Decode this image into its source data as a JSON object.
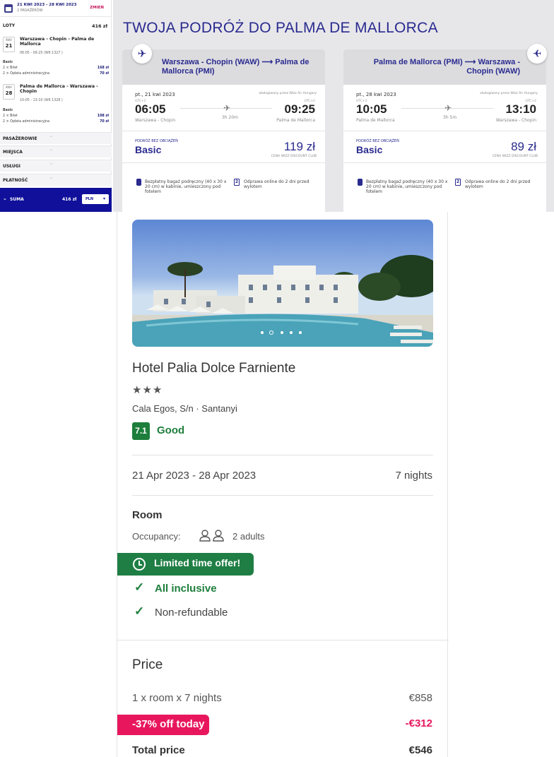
{
  "sidebar": {
    "dates": "21 KWI 2023 - 28 KWI 2023",
    "passengers": "2 PASAŻERÓW",
    "change": "ZMIEŃ",
    "flights_label": "LOTY",
    "flights_total": "416 zł",
    "flights": [
      {
        "month": "KWI",
        "day": "21",
        "route": "Warszawa - Chopin - Palma de Mallorca",
        "time": "06:05 - 09:25 (W6 1327 )",
        "fare": "Basic",
        "ticket": "2 × Bilet",
        "ticket_price": "168 zł",
        "fee": "2 × Opłata administracyjna",
        "fee_price": "70 zł"
      },
      {
        "month": "KWI",
        "day": "28",
        "route": "Palma de Mallorca - Warszawa - Chopin",
        "time": "10:05 - 13:10 (W6 1328 )",
        "fare": "Basic",
        "ticket": "2 × Bilet",
        "ticket_price": "108 zł",
        "fee": "2 × Opłata administracyjna",
        "fee_price": "70 zł"
      }
    ],
    "sections": [
      "PASAŻEROWIE",
      "MIEJSCA",
      "USŁUGI",
      "PŁATNOŚĆ"
    ],
    "sum_label": "SUMA",
    "sum_value": "416 zł",
    "currency": "PLN"
  },
  "trip": {
    "title": "TWOJA PODRÓŻ DO PALMA DE MALLORCA",
    "cards": [
      {
        "route": "Warszawa - Chopin (WAW) ⟶ Palma de Mallorca (PMI)",
        "date": "pt., 21 kwi 2023",
        "operator": "obsługiwany przez Wizz Air Hungary",
        "dep_utc": "UTC+2",
        "arr_utc": "UTC+2",
        "dep_time": "06:05",
        "arr_time": "09:25",
        "dep_airport": "Warszawa - Chopin",
        "arr_airport": "Palma de Mallorca",
        "duration": "3h 20m",
        "fare_label": "PODRÓŻ BEZ OBCIĄŻEŃ",
        "fare": "Basic",
        "price": "119 zł",
        "club": "CENA WIZZ DISCOUNT CLUB",
        "perk_bag": "Bezpłatny bagaż podręczny (40 x 30 x 20 cm) w kabinie, umieszczony pod fotelem",
        "perk_checkin": "Odprawa online do 2 dni przed wylotem",
        "checkin_icon": "2"
      },
      {
        "route": "Palma de Mallorca (PMI) ⟶ Warszawa - Chopin (WAW)",
        "date": "pt., 28 kwi 2023",
        "operator": "obsługiwany przez Wizz Air Hungary",
        "dep_utc": "UTC+2",
        "arr_utc": "UTC+2",
        "dep_time": "10:05",
        "arr_time": "13:10",
        "dep_airport": "Palma de Mallorca",
        "arr_airport": "Warszawa - Chopin",
        "duration": "3h 5m",
        "fare_label": "PODRÓŻ BEZ OBCIĄŻEŃ",
        "fare": "Basic",
        "price": "89 zł",
        "club": "CENA WIZZ DISCOUNT CLUB",
        "perk_bag": "Bezpłatny bagaż podręczny (40 x 30 x 20 cm) w kabinie, umieszczony pod fotelem",
        "perk_checkin": "Odprawa online do 2 dni przed wylotem",
        "checkin_icon": "2"
      }
    ]
  },
  "hotel": {
    "name": "Hotel Palia Dolce Farniente",
    "stars": "★★★",
    "address": "Cala Egos, S/n · Santanyi",
    "score": "7.1",
    "score_label": "Good",
    "dates": "21 Apr 2023 - 28 Apr 2023",
    "nights": "7 nights",
    "room_label": "Room",
    "occupancy_label": "Occupancy:",
    "occupancy_value": "2 adults",
    "offer": "Limited time offer!",
    "board": "All inclusive",
    "refund": "Non-refundable",
    "price_title": "Price",
    "price_line": "1 x room x 7 nights",
    "price_line_value": "€858",
    "discount": "-37% off today",
    "discount_value": "-€312",
    "total_label": "Total price",
    "total_value": "€546"
  },
  "colors": {
    "wizz_navy": "#2a2a8f",
    "wizz_blue": "#10109a",
    "wizz_pink": "#c2185b",
    "green": "#1e7e3c",
    "discount_pink": "#e8175d"
  }
}
